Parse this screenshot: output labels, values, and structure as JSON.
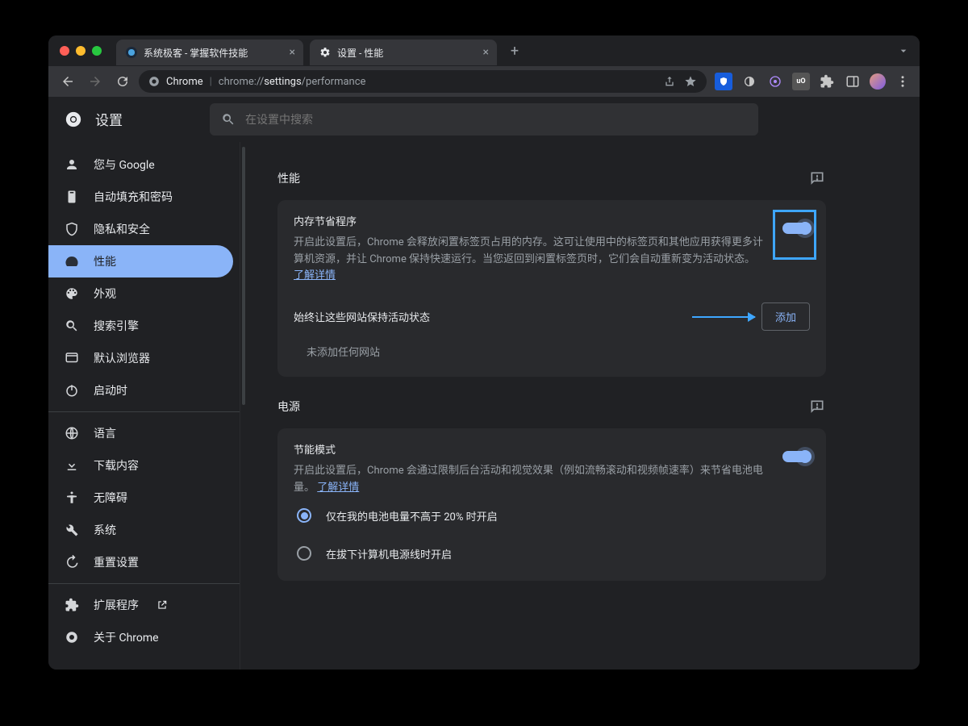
{
  "tabs": [
    {
      "title": "系统极客 - 掌握软件技能"
    },
    {
      "title": "设置 - 性能"
    }
  ],
  "toolbar": {
    "url_prefix": "Chrome",
    "url_host": "chrome://",
    "url_path_bold": "settings",
    "url_path_rest": "/performance"
  },
  "app": {
    "title": "设置",
    "search_placeholder": "在设置中搜索"
  },
  "sidebar": {
    "items": [
      {
        "label": "您与 Google"
      },
      {
        "label": "自动填充和密码"
      },
      {
        "label": "隐私和安全"
      },
      {
        "label": "性能"
      },
      {
        "label": "外观"
      },
      {
        "label": "搜索引擎"
      },
      {
        "label": "默认浏览器"
      },
      {
        "label": "启动时"
      }
    ],
    "items2": [
      {
        "label": "语言"
      },
      {
        "label": "下载内容"
      },
      {
        "label": "无障碍"
      },
      {
        "label": "系统"
      },
      {
        "label": "重置设置"
      }
    ],
    "items3": [
      {
        "label": "扩展程序"
      },
      {
        "label": "关于 Chrome"
      }
    ]
  },
  "perf": {
    "section1_title": "性能",
    "mem_saver_title": "内存节省程序",
    "mem_saver_desc": "开启此设置后，Chrome 会释放闲置标签页占用的内存。这可让使用中的标签页和其他应用获得更多计算机资源，并让 Chrome 保持快速运行。当您返回到闲置标签页时，它们会自动重新变为活动状态。",
    "learn_more": "了解详情",
    "keep_active_label": "始终让这些网站保持活动状态",
    "add_label": "添加",
    "empty_sites": "未添加任何网站",
    "section2_title": "电源",
    "energy_title": "节能模式",
    "energy_desc_1": "开启此设置后，Chrome 会通过限制后台活动和视觉效果（例如流畅滚动和视频帧速率）来节省电池电量。",
    "radio1": "仅在我的电池电量不高于 20% 时开启",
    "radio2": "在拔下计算机电源线时开启"
  }
}
